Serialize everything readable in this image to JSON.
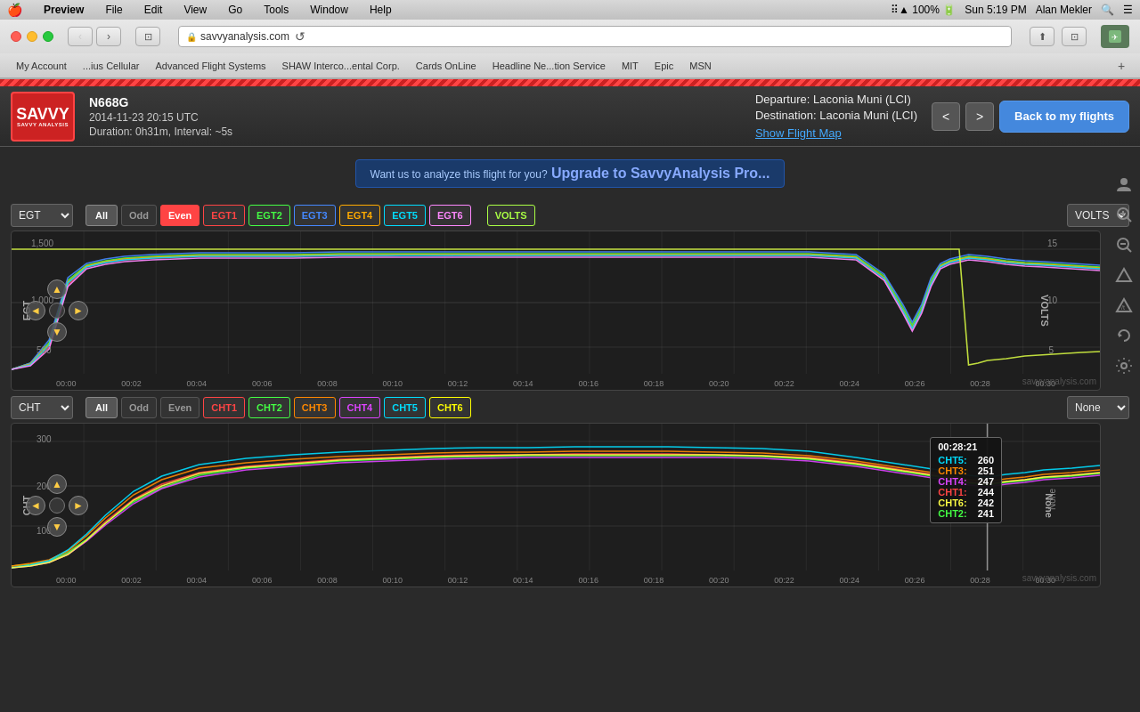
{
  "menubar": {
    "apple": "🍎",
    "items": [
      "Preview",
      "File",
      "Edit",
      "View",
      "Go",
      "Tools",
      "Window",
      "Help"
    ],
    "right_items": [
      "100%",
      "Sun 5:19 PM",
      "Alan Mekler"
    ]
  },
  "browser": {
    "url": "savvyanalysis.com",
    "bookmarks": [
      "My Account",
      "...ius Cellular",
      "Advanced Flight Systems",
      "SHAW Interco...ental Corp.",
      "Cards OnLine",
      "Headline Ne...tion Service",
      "MIT",
      "Epic",
      "MSN"
    ]
  },
  "header": {
    "logo_text": "SAVVY",
    "logo_sub": "SAVVY ANALYSIS",
    "tail_number": "N668G",
    "date": "2014-11-23 20:15 UTC",
    "duration": "Duration: 0h31m, Interval: ~5s",
    "departure": "Departure: Laconia Muni (LCI)",
    "destination": "Destination: Laconia Muni (LCI)",
    "show_map": "Show Flight Map",
    "back_button": "Back to my flights",
    "prev_label": "<",
    "next_label": ">"
  },
  "banner": {
    "text": "Want us to analyze this flight for you?",
    "link_text": "Upgrade to SavvyAnalysis Pro..."
  },
  "egt_chart": {
    "title": "EGT",
    "y_label": "EGT",
    "y_right_label": "VOLTS",
    "y_ticks": [
      "1,500",
      "1,000",
      "500"
    ],
    "y_ticks_right": [
      "15",
      "10",
      "5"
    ],
    "x_ticks": [
      "00:00",
      "00:02",
      "00:04",
      "00:06",
      "00:08",
      "00:10",
      "00:12",
      "00:14",
      "00:16",
      "00:18",
      "00:20",
      "00:22",
      "00:24",
      "00:26",
      "00:28",
      "00:30"
    ],
    "dropdown_value": "EGT",
    "dropdown_right": "VOLTS",
    "filters": {
      "all": "All",
      "odd": "Odd",
      "even": "Even",
      "egt1": "EGT1",
      "egt2": "EGT2",
      "egt3": "EGT3",
      "egt4": "EGT4",
      "egt5": "EGT5",
      "egt6": "EGT6",
      "volts": "VOLTS"
    },
    "watermark": "savvyanalysis.com"
  },
  "cht_chart": {
    "title": "CHT",
    "y_label": "CHT",
    "y_right_label": "None",
    "y_ticks": [
      "300",
      "200",
      "100"
    ],
    "x_ticks": [
      "00:00",
      "00:02",
      "00:04",
      "00:06",
      "00:08",
      "00:10",
      "00:12",
      "00:14",
      "00:16",
      "00:18",
      "00:20",
      "00:22",
      "00:24",
      "00:26",
      "00:28",
      "00:30"
    ],
    "dropdown_value": "CHT",
    "dropdown_right": "None",
    "filters": {
      "all": "All",
      "odd": "Odd",
      "even": "Even",
      "cht1": "CHT1",
      "cht2": "CHT2",
      "cht3": "CHT3",
      "cht4": "CHT4",
      "cht5": "CHT5",
      "cht6": "CHT6"
    },
    "tooltip": {
      "time": "00:28:21",
      "rows": [
        {
          "label": "CHT5:",
          "value": "260",
          "color": "#00ddff"
        },
        {
          "label": "CHT3:",
          "value": "251",
          "color": "#ff8800"
        },
        {
          "label": "CHT4:",
          "value": "247",
          "color": "#dd44ff"
        },
        {
          "label": "CHT1:",
          "value": "244",
          "color": "#ff4444"
        },
        {
          "label": "CHT6:",
          "value": "242",
          "color": "#ffff00"
        },
        {
          "label": "CHT2:",
          "value": "241",
          "color": "#44ff44"
        }
      ]
    },
    "watermark": "savvyanalysis.com"
  },
  "sidebar_icons": [
    "👤",
    "🔍",
    "🔍",
    "⚠",
    "/t",
    "↺",
    "⚙"
  ],
  "colors": {
    "background": "#2a2a2a",
    "chart_bg": "#1e1e1e",
    "accent_blue": "#4488dd",
    "egt1": "#ff4444",
    "egt2": "#44ff44",
    "egt3": "#4488ff",
    "egt4": "#ffaa00",
    "egt5": "#00ddff",
    "egt6": "#ff88ff",
    "volts": "#ddff44",
    "cht1": "#ff4444",
    "cht2": "#44ff44",
    "cht3": "#ff8800",
    "cht4": "#dd44ff",
    "cht5": "#00ddff",
    "cht6": "#ffff44"
  }
}
